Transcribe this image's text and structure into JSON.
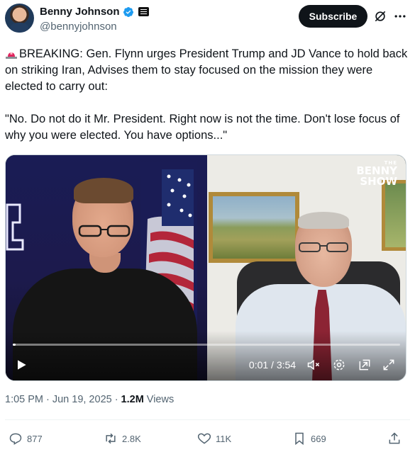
{
  "author": {
    "name": "Benny Johnson",
    "handle": "@bennyjohnson",
    "verified": true,
    "verified_color": "#1d9bf0"
  },
  "header": {
    "subscribe_label": "Subscribe"
  },
  "tweet": {
    "line1": "BREAKING: Gen. Flynn urges President Trump and JD Vance to hold back on striking Iran, Advises them to stay focused on the mission they were elected to carry out:",
    "line2": "\"No. Do not do it Mr. President. Right now is not the time. Don't lose focus of why you were elected. You have options...\"",
    "emoji_icon": "police-siren-icon"
  },
  "video": {
    "logo_the": "THE",
    "logo_benny": "BENNY",
    "logo_show": "SHOW",
    "time": "0:01 / 3:54",
    "progress": 0.004
  },
  "meta": {
    "time": "1:05 PM",
    "sep1": "·",
    "date": "Jun 19, 2025",
    "sep2": "·",
    "views_count": "1.2M",
    "views_label": "Views"
  },
  "actions": {
    "replies": "877",
    "reposts": "2.8K",
    "likes": "11K",
    "bookmarks": "669"
  }
}
